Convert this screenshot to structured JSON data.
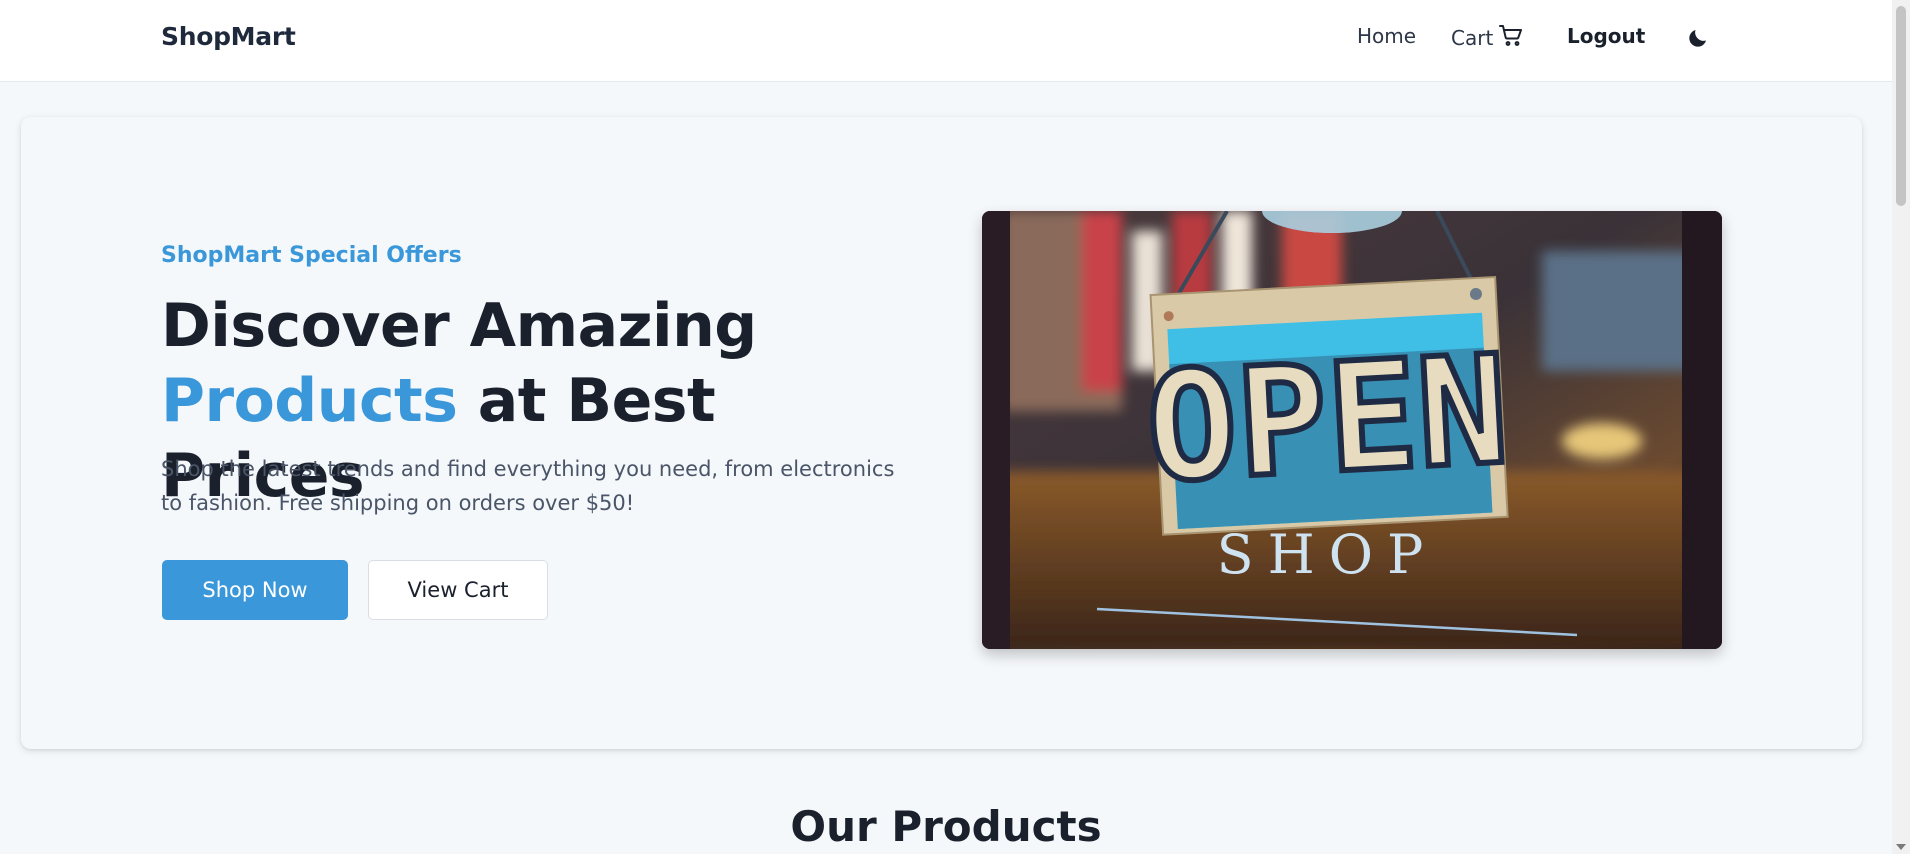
{
  "navbar": {
    "brand": "ShopMart",
    "links": {
      "home": "Home",
      "cart": "Cart",
      "logout": "Logout"
    },
    "icons": {
      "cart": "cart-icon",
      "theme": "moon-icon"
    }
  },
  "hero": {
    "eyebrow": "ShopMart Special Offers",
    "headline_line1": "Discover Amazing",
    "headline_accent": "Products",
    "headline_rest": " at Best Prices",
    "lead": "Shop the latest trends and find everything you need, from electronics to fashion. Free shipping on orders over $50!",
    "primary_button": "Shop Now",
    "secondary_button": "View Cart",
    "image": {
      "sign_text": "OPEN",
      "sub_text": "SHOP"
    }
  },
  "section": {
    "title": "Our Products"
  },
  "colors": {
    "accent": "#3a97d9",
    "text": "#1a202c",
    "muted": "#4a5568",
    "background": "#f5f8fb"
  }
}
